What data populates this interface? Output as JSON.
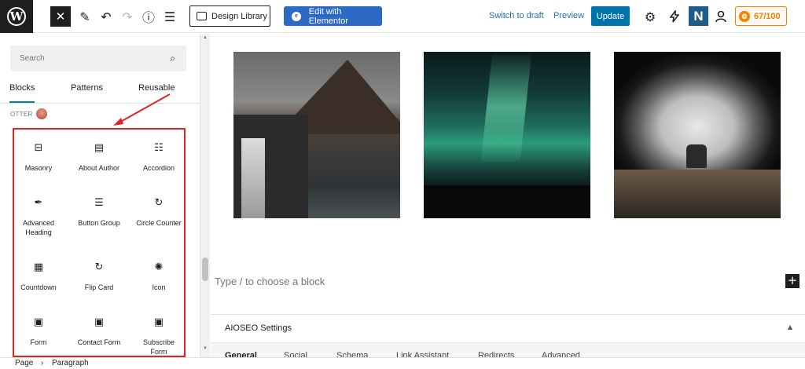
{
  "toolbar": {
    "close_glyph": "✕",
    "pen_glyph": "✎",
    "undo_glyph": "↶",
    "redo_glyph": "↷",
    "info_glyph": "ⓘ",
    "outline_glyph": "☰",
    "design_library_label": "Design Library",
    "edit_elementor_label": "Edit with Elementor",
    "switch_to_draft_label": "Switch to draft",
    "preview_label": "Preview",
    "update_label": "Update",
    "settings_glyph": "⚙",
    "n_badge_label": "N",
    "score_label": "67/100"
  },
  "sidebar": {
    "search_placeholder": "Search",
    "tabs": [
      {
        "label": "Blocks"
      },
      {
        "label": "Patterns"
      },
      {
        "label": "Reusable"
      }
    ],
    "category_label": "OTTER",
    "blocks": [
      {
        "label": "Masonry",
        "icon": "masonry-icon",
        "glyph": "⊟"
      },
      {
        "label": "About Author",
        "icon": "about-author-icon",
        "glyph": "▤"
      },
      {
        "label": "Accordion",
        "icon": "accordion-icon",
        "glyph": "☷"
      },
      {
        "label": "Advanced Heading",
        "icon": "advanced-heading-icon",
        "glyph": "✒"
      },
      {
        "label": "Button Group",
        "icon": "button-group-icon",
        "glyph": "☰"
      },
      {
        "label": "Circle Counter",
        "icon": "circle-counter-icon",
        "glyph": "↻"
      },
      {
        "label": "Countdown",
        "icon": "countdown-icon",
        "glyph": "▦"
      },
      {
        "label": "Flip Card",
        "icon": "flip-card-icon",
        "glyph": "↻"
      },
      {
        "label": "Icon",
        "icon": "icon-block-icon",
        "glyph": "✺"
      },
      {
        "label": "Form",
        "icon": "form-icon",
        "glyph": "▣"
      },
      {
        "label": "Contact Form",
        "icon": "contact-form-icon",
        "glyph": "▣"
      },
      {
        "label": "Subscribe Form",
        "icon": "subscribe-form-icon",
        "glyph": "▣"
      }
    ]
  },
  "canvas": {
    "images": [
      {
        "icon": "mountain-waterfall-image"
      },
      {
        "icon": "aurora-image"
      },
      {
        "icon": "sea-cave-image"
      }
    ],
    "placeholder": "Type / to choose a block",
    "add_glyph": "+"
  },
  "aioseo": {
    "title": "AIOSEO Settings",
    "caret": "▲",
    "tabs": [
      {
        "label": "General"
      },
      {
        "label": "Social"
      },
      {
        "label": "Schema"
      },
      {
        "label": "Link Assistant"
      },
      {
        "label": "Redirects"
      },
      {
        "label": "Advanced"
      }
    ]
  },
  "breadcrumb": {
    "page": "Page",
    "separator": "›",
    "paragraph": "Paragraph"
  },
  "colors": {
    "elementor_blue": "#2c6ac5",
    "update_blue": "#0073aa",
    "highlight_red": "#e02424",
    "score_orange": "#f18200"
  }
}
